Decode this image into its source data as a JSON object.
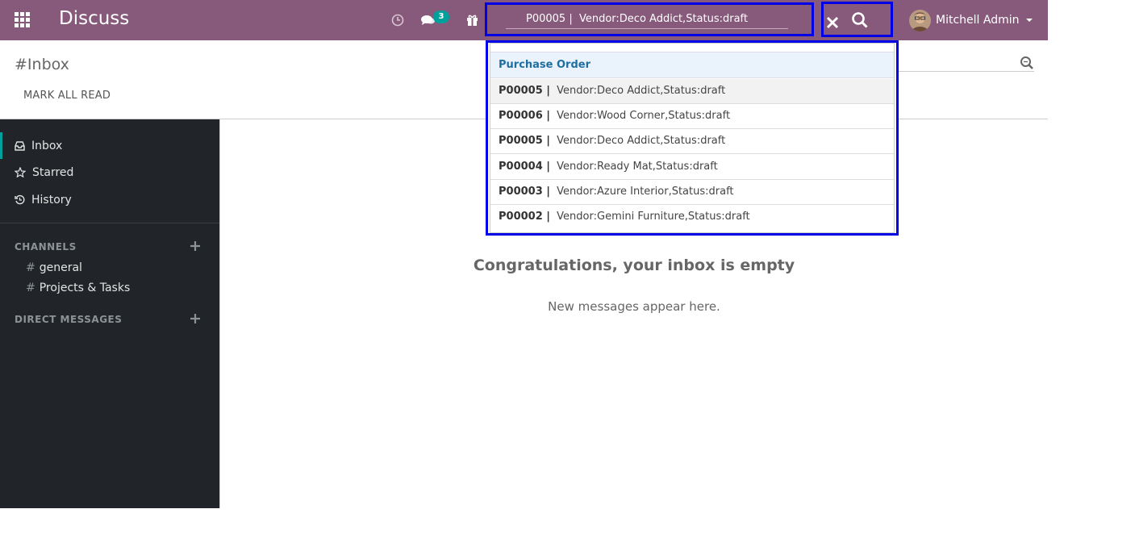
{
  "app": {
    "title": "Discuss"
  },
  "navbar": {
    "chat_badge": "3",
    "search_value": "P00005 |  Vendor:Deco Addict,Status:draft",
    "user_name": "Mitchell Admin"
  },
  "control_panel": {
    "breadcrumb": "#Inbox",
    "mark_all_read": "MARK ALL READ"
  },
  "sidebar": {
    "items": [
      {
        "label": "Inbox",
        "icon": "inbox-icon"
      },
      {
        "label": "Starred",
        "icon": "star-icon"
      },
      {
        "label": "History",
        "icon": "history-icon"
      }
    ],
    "channels_header": "CHANNELS",
    "channels": [
      {
        "hash": "#",
        "name": "general"
      },
      {
        "hash": "#",
        "name": "Projects & Tasks"
      }
    ],
    "direct_messages_header": "DIRECT MESSAGES"
  },
  "main": {
    "empty_title": "Congratulations, your inbox is empty",
    "empty_subtitle": "New messages appear here."
  },
  "dropdown": {
    "header": "Purchase Order",
    "items": [
      {
        "code": "P00005 |",
        "text": "Vendor:Deco Addict,Status:draft"
      },
      {
        "code": "P00006 |",
        "text": "Vendor:Wood Corner,Status:draft"
      },
      {
        "code": "P00005 |",
        "text": "Vendor:Deco Addict,Status:draft"
      },
      {
        "code": "P00004 |",
        "text": "Vendor:Ready Mat,Status:draft"
      },
      {
        "code": "P00003 |",
        "text": "Vendor:Azure Interior,Status:draft"
      },
      {
        "code": "P00002 |",
        "text": "Vendor:Gemini Furniture,Status:draft"
      }
    ]
  },
  "colors": {
    "navbar": "#875a7b",
    "sidebar": "#212529",
    "accent": "#00a09d",
    "highlight_border": "#0000e6"
  }
}
